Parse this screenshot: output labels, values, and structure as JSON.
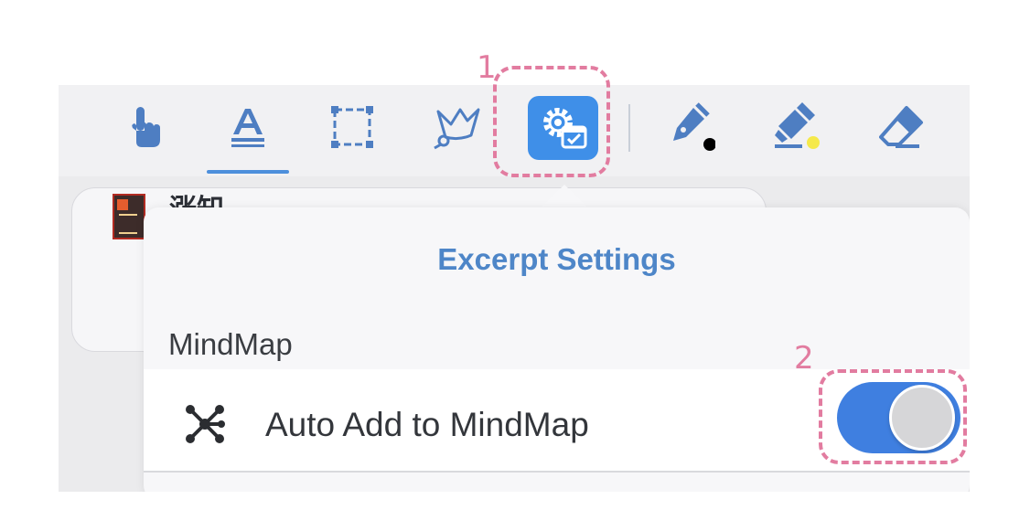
{
  "toolbar": {
    "tools": [
      {
        "name": "hand-tool",
        "icon": "pointing-hand-icon"
      },
      {
        "name": "text-select-tool",
        "icon": "text-underline-icon",
        "active": true
      },
      {
        "name": "rectangle-select-tool",
        "icon": "dashed-rectangle-icon"
      },
      {
        "name": "lasso-tool",
        "icon": "lasso-icon"
      },
      {
        "name": "excerpt-settings-tool",
        "icon": "gear-settings-icon",
        "selected": true
      },
      {
        "name": "pen-tool",
        "icon": "fountain-pen-icon",
        "dot_color": "#000000"
      },
      {
        "name": "highlighter-tool",
        "icon": "highlighter-icon",
        "dot_color": "#f5e94a"
      },
      {
        "name": "eraser-tool",
        "icon": "eraser-icon"
      }
    ],
    "accent_color": "#3f8fe8",
    "icon_color": "#4e7ec2"
  },
  "document": {
    "title": "涨知"
  },
  "popover": {
    "title": "Excerpt Settings",
    "section": "MindMap",
    "rows": [
      {
        "icon": "mindmap-node-icon",
        "label": "Auto Add to MindMap",
        "toggle_on": true
      }
    ]
  },
  "annotations": {
    "callout_1": "1",
    "callout_2": "2",
    "callout_color": "#e27ca0"
  }
}
